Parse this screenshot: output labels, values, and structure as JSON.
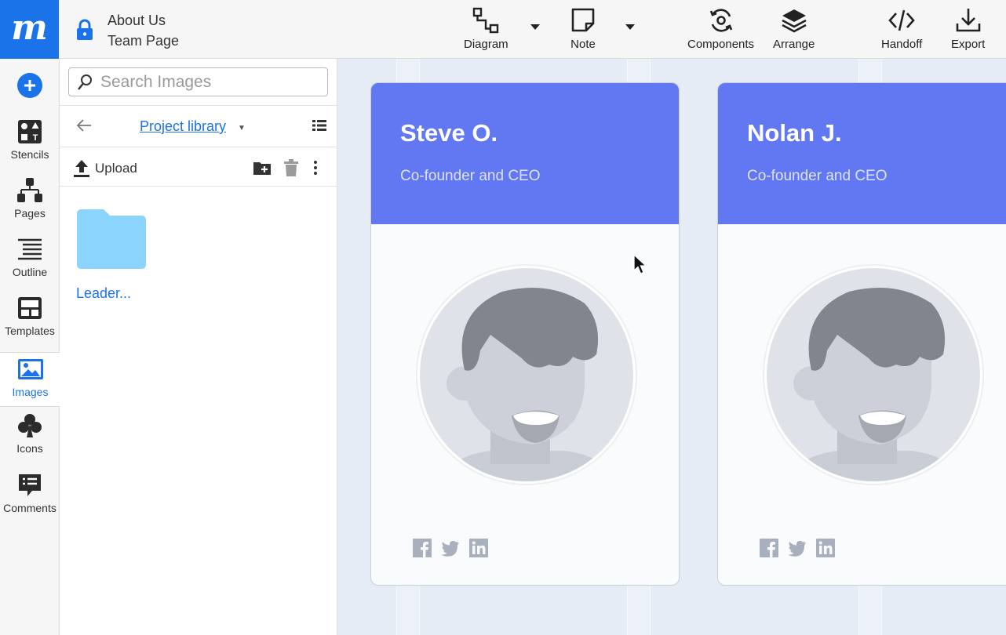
{
  "app": {
    "logo_letter": "m",
    "doc_title": "About Us",
    "page_name": "Team Page"
  },
  "toolbar": {
    "diagram": "Diagram",
    "note": "Note",
    "components": "Components",
    "arrange": "Arrange",
    "handoff": "Handoff",
    "export": "Export"
  },
  "rail": {
    "stencils": "Stencils",
    "pages": "Pages",
    "outline": "Outline",
    "templates": "Templates",
    "images": "Images",
    "icons": "Icons",
    "comments": "Comments"
  },
  "panel": {
    "search_placeholder": "Search Images",
    "library": "Project library",
    "upload": "Upload",
    "folder_name": "Leader..."
  },
  "cards": [
    {
      "name": "Steve O.",
      "role": "Co-founder and CEO"
    },
    {
      "name": "Nolan J.",
      "role": "Co-founder and CEO"
    }
  ],
  "colors": {
    "brand": "#1a73e8",
    "card_header": "#6278f3",
    "folder": "#8ad4fd"
  }
}
